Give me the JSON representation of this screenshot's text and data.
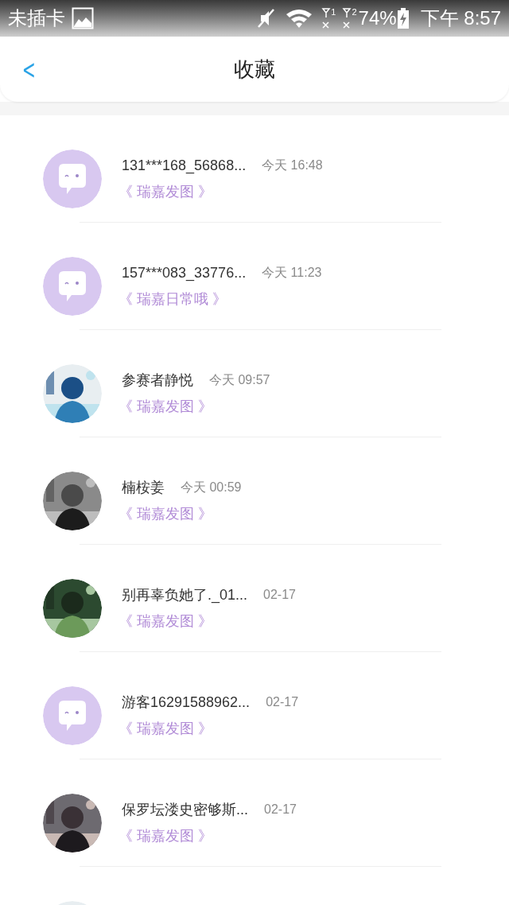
{
  "status_bar": {
    "carrier": "未插卡",
    "sim_slots": [
      "1",
      "2"
    ],
    "battery": "74%",
    "time": "下午 8:57"
  },
  "header": {
    "back": "<",
    "title": "收藏"
  },
  "items": [
    {
      "avatar": {
        "kind": "default"
      },
      "name": "131***168_56868...",
      "time": "今天 16:48",
      "collection": "《 瑞嘉发图 》"
    },
    {
      "avatar": {
        "kind": "default"
      },
      "name": "157***083_33776...",
      "time": "今天 11:23",
      "collection": "《 瑞嘉日常哦 》"
    },
    {
      "avatar": {
        "kind": "picture"
      },
      "name": "参赛者静悦",
      "time": "今天 09:57",
      "collection": "《 瑞嘉发图 》"
    },
    {
      "avatar": {
        "kind": "picture"
      },
      "name": "楠桉姜",
      "time": "今天 00:59",
      "collection": "《 瑞嘉发图 》"
    },
    {
      "avatar": {
        "kind": "picture"
      },
      "name": "别再辜负她了._01...",
      "time": "02-17",
      "collection": "《 瑞嘉发图 》"
    },
    {
      "avatar": {
        "kind": "default"
      },
      "name": "游客16291588962...",
      "time": "02-17",
      "collection": "《 瑞嘉发图 》"
    },
    {
      "avatar": {
        "kind": "picture"
      },
      "name": "保罗坛溇史密够斯...",
      "time": "02-17",
      "collection": "《 瑞嘉发图 》"
    },
    {
      "avatar": {
        "kind": "picture"
      }
    }
  ]
}
